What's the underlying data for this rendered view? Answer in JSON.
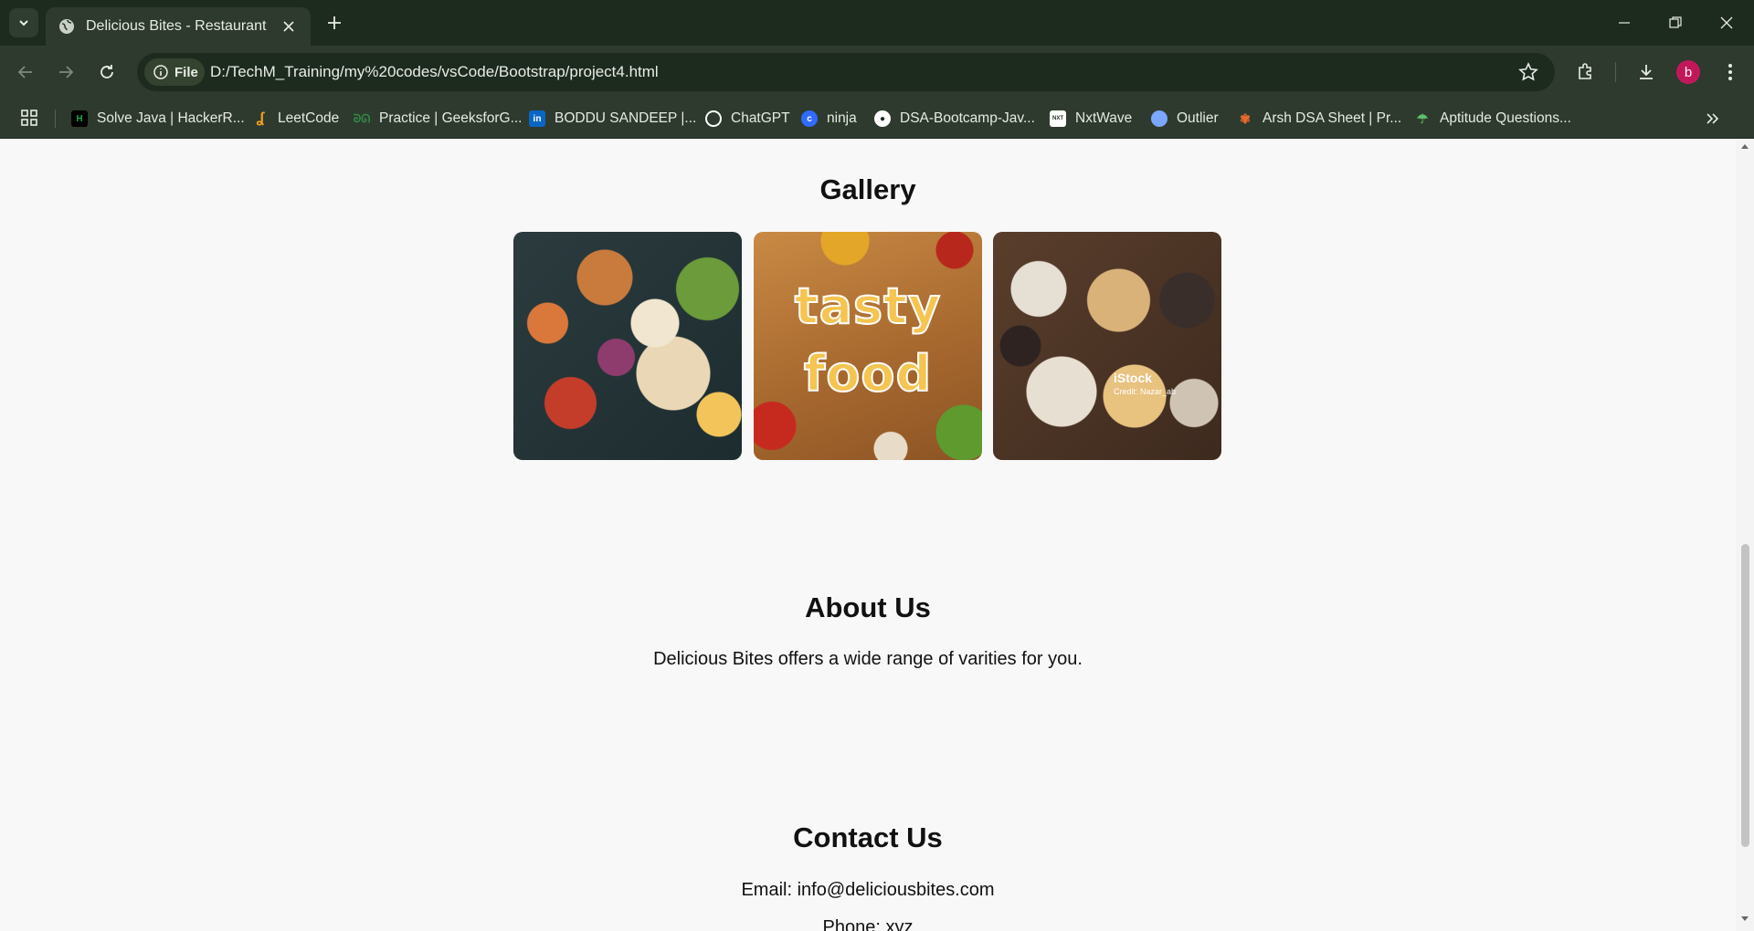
{
  "browser": {
    "tab_title": "Delicious Bites - Restaurant",
    "site_chip_label": "File",
    "url": "D:/TechM_Training/my%20codes/vsCode/Bootstrap/project4.html",
    "profile_initial": "b",
    "bookmarks": [
      {
        "label": "Solve Java | HackerR...",
        "icon": "hackerrank-icon",
        "color": "#1ba94c"
      },
      {
        "label": "LeetCode",
        "icon": "leetcode-icon",
        "color": "#f89f1b"
      },
      {
        "label": "Practice | GeeksforG...",
        "icon": "geeksforgeeks-icon",
        "color": "#2f8d46"
      },
      {
        "label": "BODDU SANDEEP |...",
        "icon": "linkedin-icon",
        "color": "#0a66c2"
      },
      {
        "label": "ChatGPT",
        "icon": "chatgpt-icon",
        "color": "#ffffff"
      },
      {
        "label": "ninja",
        "icon": "ninja-icon",
        "color": "#2f6bff"
      },
      {
        "label": "DSA-Bootcamp-Jav...",
        "icon": "github-icon",
        "color": "#ffffff"
      },
      {
        "label": "NxtWave",
        "icon": "nxtwave-icon",
        "color": "#ffffff"
      },
      {
        "label": "Outlier",
        "icon": "outlier-icon",
        "color": "#7aa7ff"
      },
      {
        "label": "Arsh DSA Sheet | Pr...",
        "icon": "arsh-dsa-icon",
        "color": "#e8692a"
      },
      {
        "label": "Aptitude Questions...",
        "icon": "aptitude-icon",
        "color": "#5fbf6a"
      }
    ]
  },
  "page": {
    "gallery_title": "Gallery",
    "gallery_images": [
      {
        "alt": "bowls of fresh food"
      },
      {
        "caption_line1": "tasty",
        "caption_line2": "food"
      },
      {
        "watermark": "iStock",
        "credit": "Credit: Nazar_ab"
      }
    ],
    "about_title": "About Us",
    "about_text": "Delicious Bites offers a wide range of varities for you.",
    "contact_title": "Contact Us",
    "contact_email": "Email: info@deliciousbites.com",
    "contact_phone": "Phone: xyz"
  },
  "colors": {
    "chrome_dark": "#1d2b1f",
    "chrome_toolbar": "#2e3a2d",
    "page_bg": "#f8f8f8",
    "avatar": "#c2185b"
  }
}
